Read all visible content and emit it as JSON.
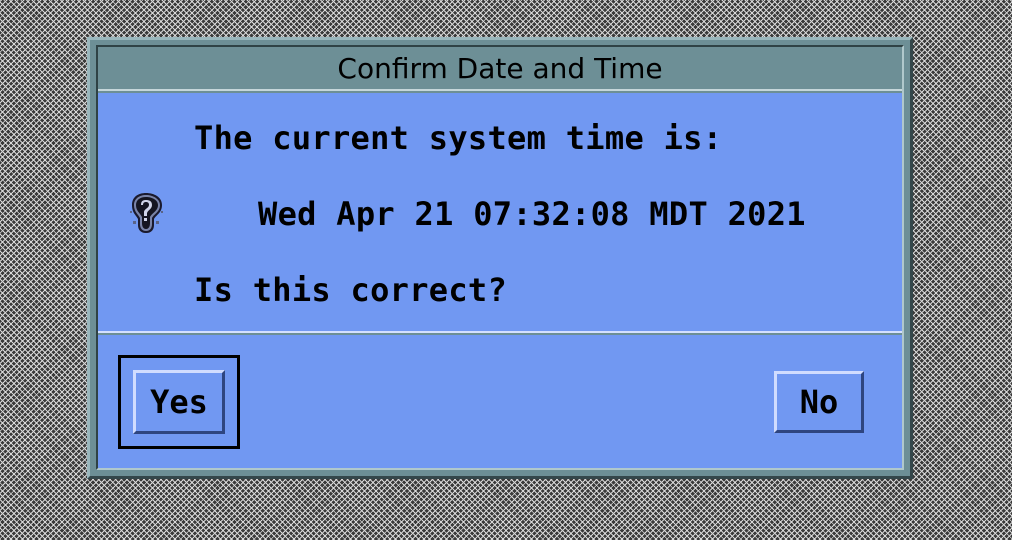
{
  "dialog": {
    "title": "Confirm Date and Time",
    "message": {
      "line1": "The current system time is:",
      "line2": "Wed Apr 21 07:32:08 MDT 2021",
      "line3": "Is this correct?"
    },
    "icon": "question-icon",
    "buttons": {
      "yes_label": "Yes",
      "no_label": "No",
      "default": "yes"
    }
  },
  "colors": {
    "title_bar": "#6d8f96",
    "body": "#7198f2",
    "text": "#000000"
  }
}
